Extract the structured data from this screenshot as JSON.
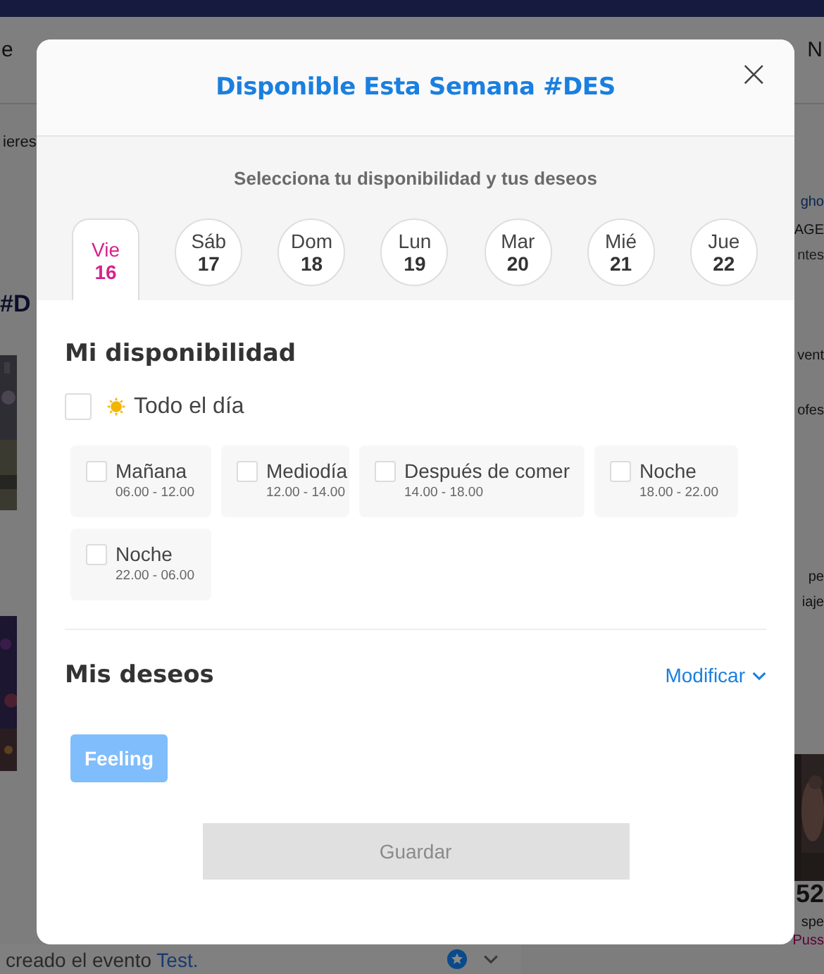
{
  "backdrop": {
    "nav": [
      {
        "label": "e"
      },
      {
        "label": "N"
      }
    ],
    "fragments": [
      {
        "text": "ieres",
        "kind": "plain"
      },
      {
        "text": "#D",
        "kind": "heading"
      },
      {
        "text": "gho",
        "kind": "link"
      },
      {
        "text": "AGE",
        "kind": "plain"
      },
      {
        "text": "ntes",
        "kind": "muted"
      },
      {
        "text": "vent",
        "kind": "plain"
      },
      {
        "text": "ofes",
        "kind": "plain"
      },
      {
        "text": "pe",
        "kind": "plain"
      },
      {
        "text": "iaje",
        "kind": "plain"
      },
      {
        "text": "52",
        "kind": "number"
      },
      {
        "text": "spe",
        "kind": "plain"
      },
      {
        "text": "Puss",
        "kind": "pink"
      }
    ],
    "activity": {
      "text": "creado el evento ",
      "link": "Test."
    }
  },
  "modal": {
    "title": "Disponible Esta Semana #DES",
    "close": "×",
    "subtitle": "Selecciona tu disponibilidad y tus deseos",
    "days": [
      {
        "name": "Vie",
        "date": "16",
        "selected": true
      },
      {
        "name": "Sáb",
        "date": "17",
        "selected": false
      },
      {
        "name": "Dom",
        "date": "18",
        "selected": false
      },
      {
        "name": "Lun",
        "date": "19",
        "selected": false
      },
      {
        "name": "Mar",
        "date": "20",
        "selected": false
      },
      {
        "name": "Mié",
        "date": "21",
        "selected": false
      },
      {
        "name": "Jue",
        "date": "22",
        "selected": false
      }
    ],
    "availability_title": "Mi disponibilidad",
    "all_day": {
      "label": "Todo el día",
      "checked": false
    },
    "slots": [
      {
        "label": "Mañana",
        "time": "06.00 - 12.00",
        "checked": false
      },
      {
        "label": "Mediodía",
        "time": "12.00 - 14.00",
        "checked": false
      },
      {
        "label": "Después de comer",
        "time": "14.00 - 18.00",
        "checked": false
      },
      {
        "label": "Noche",
        "time": "18.00 - 22.00",
        "checked": false
      },
      {
        "label": "Noche",
        "time": "22.00 - 06.00",
        "checked": false
      }
    ],
    "wishes_title": "Mis deseos",
    "modify": "Modificar",
    "wishes": [
      {
        "label": "Feeling"
      }
    ],
    "save": {
      "label": "Guardar",
      "disabled": true
    }
  }
}
